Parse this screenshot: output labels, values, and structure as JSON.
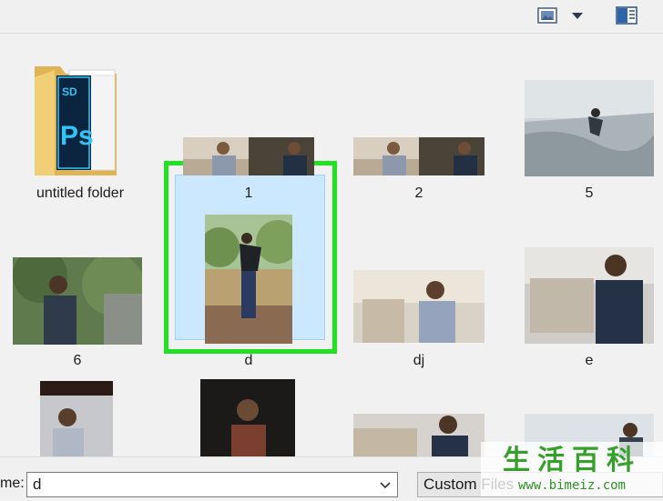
{
  "toolbar": {
    "view_icon": "picture-view-icon",
    "dropdown_icon": "caret-down-icon",
    "pane_icon": "preview-pane-icon"
  },
  "files": [
    {
      "name": "untitled folder",
      "kind": "folder"
    },
    {
      "name": "1",
      "kind": "image"
    },
    {
      "name": "2",
      "kind": "image"
    },
    {
      "name": "5",
      "kind": "image"
    },
    {
      "name": "6",
      "kind": "image"
    },
    {
      "name": "d",
      "kind": "image",
      "selected": true
    },
    {
      "name": "dj",
      "kind": "image"
    },
    {
      "name": "e",
      "kind": "image"
    }
  ],
  "folder_badge": {
    "top": "SD",
    "main": "Ps"
  },
  "bottom": {
    "filename_label": "me:",
    "filename_value": "d",
    "filetype_value": "Custom Files"
  },
  "watermark": {
    "title": "生活百科",
    "url": "www.bimeiz.com"
  },
  "colors": {
    "selection_outline": "#22e022",
    "selection_fill": "#cce8ff",
    "folder": "#e8c46a",
    "ps_blue": "#31c5f4"
  }
}
